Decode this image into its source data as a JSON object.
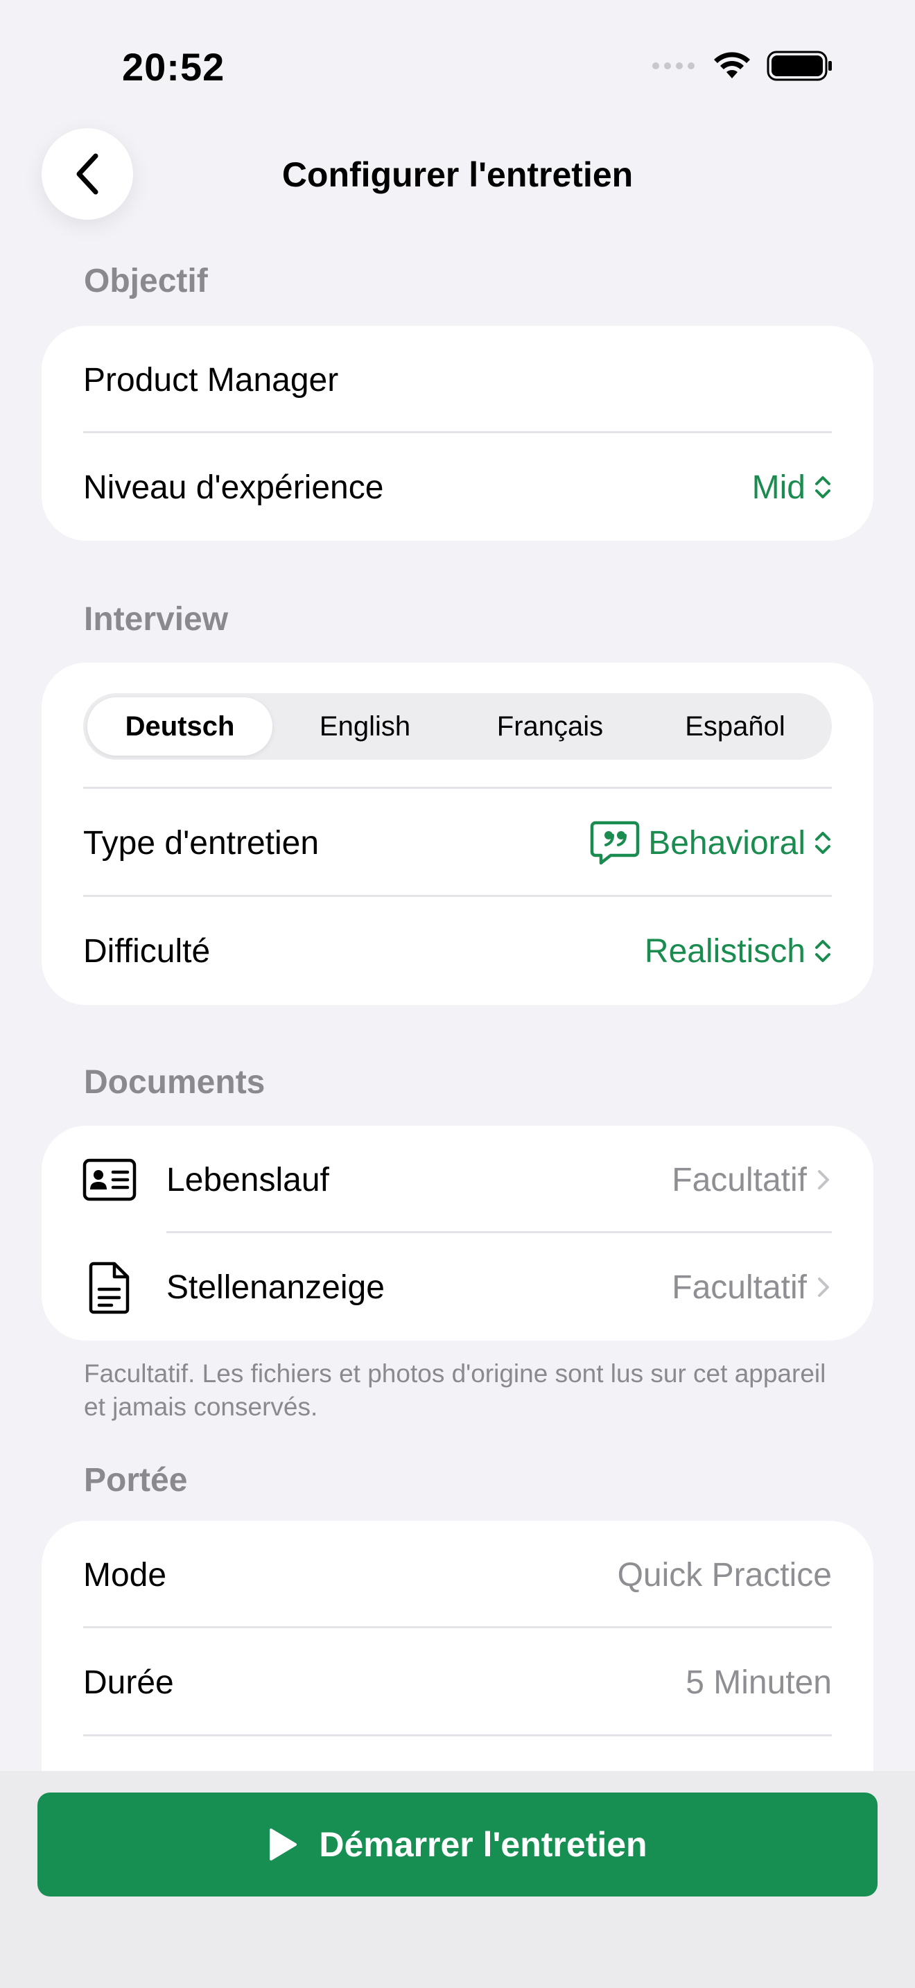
{
  "status": {
    "time": "20:52"
  },
  "header": {
    "title": "Configurer l'entretien"
  },
  "objectif": {
    "label": "Objectif",
    "role": "Product Manager",
    "experience_label": "Niveau d'expérience",
    "experience_value": "Mid"
  },
  "interview": {
    "label": "Interview",
    "languages": [
      "Deutsch",
      "English",
      "Français",
      "Español"
    ],
    "selected_language": "Deutsch",
    "type_label": "Type d'entretien",
    "type_value": "Behavioral",
    "difficulty_label": "Difficulté",
    "difficulty_value": "Realistisch"
  },
  "documents": {
    "label": "Documents",
    "items": [
      {
        "label": "Lebenslauf",
        "value": "Facultatif",
        "icon": "id-card-icon"
      },
      {
        "label": "Stellenanzeige",
        "value": "Facultatif",
        "icon": "document-icon"
      }
    ],
    "footnote": "Facultatif. Les fichiers et photos d'origine sont lus sur cet appareil et jamais conservés."
  },
  "portee": {
    "label": "Portée",
    "mode_label": "Mode",
    "mode_value": "Quick Practice",
    "duration_label": "Durée",
    "duration_value": "5 Minuten"
  },
  "start_button": {
    "label": "Démarrer l'entretien"
  },
  "colors": {
    "accent": "#188f52",
    "accent_text": "#1a8c4f",
    "background": "#f2f2f7",
    "secondary_text": "#8e8e93"
  }
}
